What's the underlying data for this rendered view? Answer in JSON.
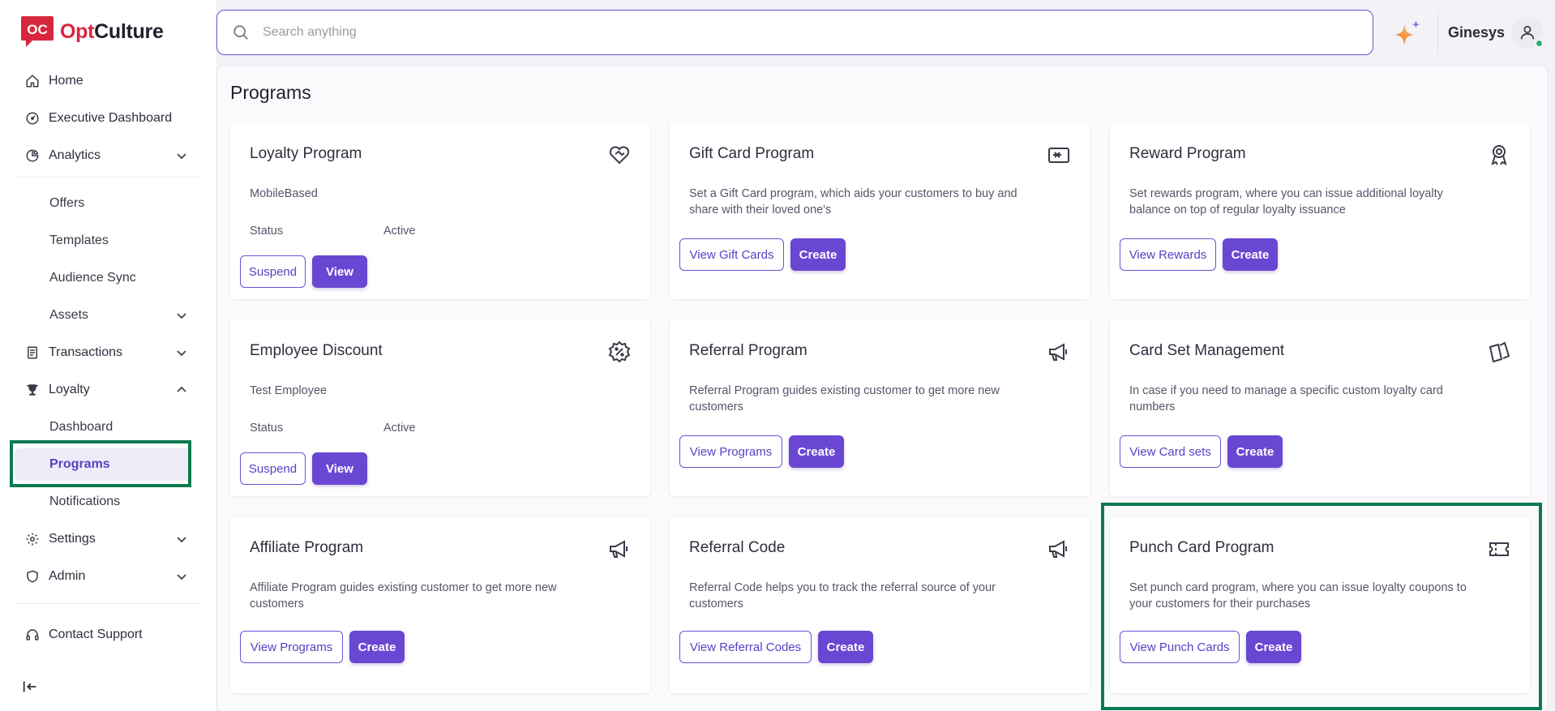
{
  "brand": {
    "name_part1": "Opt",
    "name_part2": "Culture",
    "accent": "#d7263d"
  },
  "search": {
    "placeholder": "Search anything"
  },
  "header": {
    "user_name": "Ginesys"
  },
  "sidebar": {
    "items": [
      {
        "label": "Home",
        "icon": "home-icon"
      },
      {
        "label": "Executive Dashboard",
        "icon": "gauge-icon"
      },
      {
        "label": "Analytics",
        "icon": "pie-chart-icon"
      },
      {
        "label": "Offers"
      },
      {
        "label": "Templates"
      },
      {
        "label": "Audience Sync"
      },
      {
        "label": "Assets"
      },
      {
        "label": "Transactions",
        "icon": "receipt-icon"
      },
      {
        "label": "Loyalty",
        "icon": "trophy-icon"
      },
      {
        "label": "Dashboard"
      },
      {
        "label": "Programs"
      },
      {
        "label": "Notifications"
      },
      {
        "label": "Settings",
        "icon": "gear-icon"
      },
      {
        "label": "Admin",
        "icon": "shield-icon"
      },
      {
        "label": "Contact Support",
        "icon": "headset-icon"
      }
    ]
  },
  "main": {
    "title": "Programs",
    "cards": [
      {
        "title": "Loyalty Program",
        "icon": "heart-handshake-icon",
        "desc": "MobileBased",
        "status_label": "Status",
        "status_value": "Active",
        "btn1": "Suspend",
        "btn2": "View"
      },
      {
        "title": "Gift Card Program",
        "icon": "gift-card-icon",
        "desc": "Set a Gift Card program, which aids your customers to buy and share with their loved one's",
        "btn1": "View Gift Cards",
        "btn2": "Create"
      },
      {
        "title": "Reward Program",
        "icon": "award-icon",
        "desc": "Set rewards program, where you can issue additional loyalty balance on top of regular loyalty issuance",
        "btn1": "View Rewards",
        "btn2": "Create"
      },
      {
        "title": "Employee Discount",
        "icon": "discount-badge-icon",
        "desc": "Test Employee",
        "status_label": "Status",
        "status_value": "Active",
        "btn1": "Suspend",
        "btn2": "View"
      },
      {
        "title": "Referral Program",
        "icon": "megaphone-icon",
        "desc": "Referral Program guides existing customer to get more new customers",
        "btn1": "View Programs",
        "btn2": "Create"
      },
      {
        "title": "Card Set Management",
        "icon": "cards-icon",
        "desc": "In case if you need to manage a specific custom loyalty card numbers",
        "btn1": "View Card sets",
        "btn2": "Create"
      },
      {
        "title": "Affiliate Program",
        "icon": "megaphone-icon",
        "desc": "Affiliate Program guides existing customer to get more new customers",
        "btn1": "View Programs",
        "btn2": "Create"
      },
      {
        "title": "Referral Code",
        "icon": "megaphone-icon",
        "desc": "Referral Code helps you to track the referral source of your customers",
        "btn1": "View Referral Codes",
        "btn2": "Create"
      },
      {
        "title": "Punch Card Program",
        "icon": "ticket-icon",
        "desc": "Set punch card program, where you can issue loyalty coupons to your customers for their purchases",
        "btn1": "View Punch Cards",
        "btn2": "Create"
      }
    ]
  }
}
